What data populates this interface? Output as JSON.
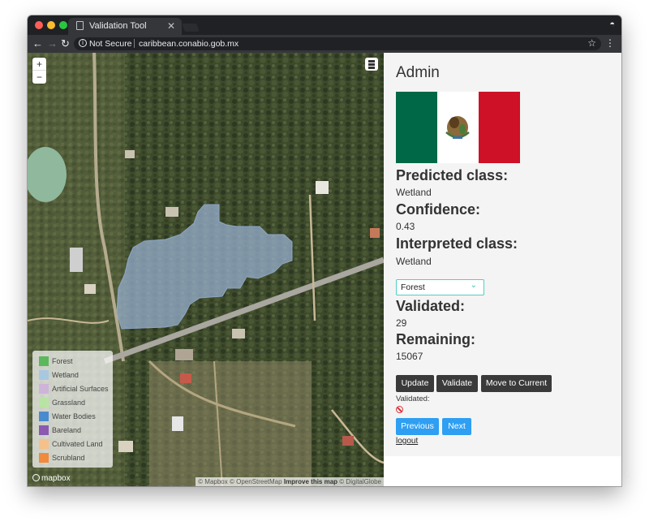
{
  "browser": {
    "tab_title": "Validation Tool",
    "security_label": "Not Secure",
    "url": "caribbean.conabio.gob.mx"
  },
  "map": {
    "zoom_in": "+",
    "zoom_out": "−",
    "legend": [
      {
        "label": "Forest",
        "color": "#5cb85c"
      },
      {
        "label": "Wetland",
        "color": "#a8c8e0"
      },
      {
        "label": "Artificial Surfaces",
        "color": "#cdb4d8"
      },
      {
        "label": "Grassland",
        "color": "#b9e3a5"
      },
      {
        "label": "Water Bodies",
        "color": "#4a8bd0"
      },
      {
        "label": "Bareland",
        "color": "#8a5ab0"
      },
      {
        "label": "Cultivated Land",
        "color": "#f5c08a"
      },
      {
        "label": "Scrubland",
        "color": "#f08a3c"
      }
    ],
    "logo_text": "mapbox",
    "attribution": {
      "prefix": "© Mapbox © OpenStreetMap",
      "improve": "Improve this map",
      "suffix": "© DigitalGlobe"
    }
  },
  "panel": {
    "user": "Admin",
    "predicted_heading": "Predicted class:",
    "predicted_value": "Wetland",
    "confidence_heading": "Confidence:",
    "confidence_value": "0.43",
    "interpreted_heading": "Interpreted class:",
    "interpreted_value": "Wetland",
    "select_value": "Forest",
    "validated_heading": "Validated:",
    "validated_value": "29",
    "remaining_heading": "Remaining:",
    "remaining_value": "15067",
    "update_label": "Update",
    "validate_label": "Validate",
    "move_label": "Move to Current",
    "validated_small": "Validated:",
    "previous_label": "Previous",
    "next_label": "Next",
    "logout_label": "logout"
  }
}
